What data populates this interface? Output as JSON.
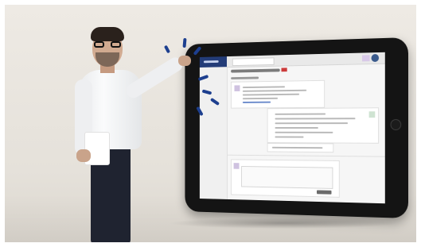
{
  "scene": {
    "background_color": "#e9e5df",
    "accent_color": "#1d3f8f"
  },
  "person": {
    "description_icon": "waiter-icon"
  },
  "tablet": {
    "screen_icon": "chat-app-icon",
    "brand_color": "#233c78"
  }
}
